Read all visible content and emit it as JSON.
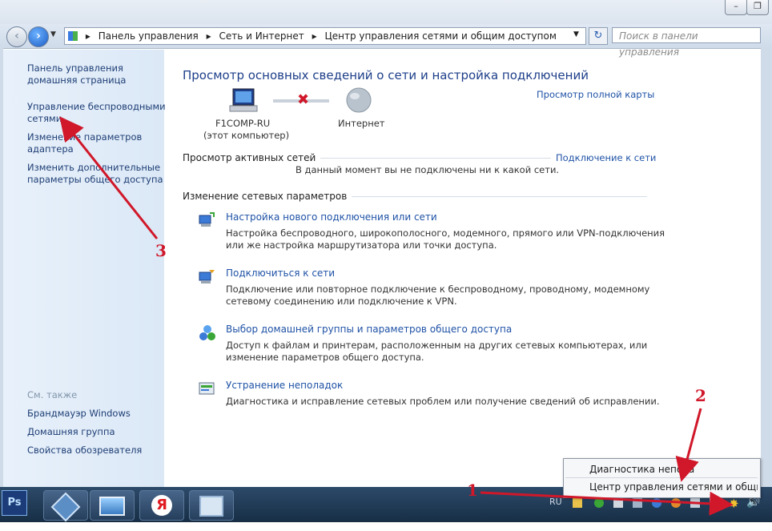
{
  "address": {
    "crumbs": [
      "Панель управления",
      "Сеть и Интернет",
      "Центр управления сетями и общим доступом"
    ],
    "search_placeholder": "Поиск в панели управления"
  },
  "sidebar": {
    "items": [
      {
        "label": "Панель управления\nдомашняя страница"
      },
      {
        "label": "Управление беспроводными\nсетями"
      },
      {
        "label": "Изменение параметров\nадаптера"
      },
      {
        "label": "Изменить дополнительные\nпараметры общего доступа"
      }
    ],
    "see_also": "См. также",
    "see_items": [
      "Брандмауэр Windows",
      "Домашняя группа",
      "Свойства обозревателя"
    ]
  },
  "main": {
    "title": "Просмотр основных сведений о сети и настройка подключений",
    "full_map_link": "Просмотр полной карты",
    "computer_name": "F1COMP-RU",
    "computer_sub": "(этот компьютер)",
    "internet_label": "Интернет",
    "active_networks_label": "Просмотр активных сетей",
    "connect_link": "Подключение к сети",
    "no_connection": "В данный момент вы не подключены ни к какой сети.",
    "change_settings_label": "Изменение сетевых параметров",
    "actions": [
      {
        "title": "Настройка нового подключения или сети",
        "desc": "Настройка беспроводного, широкополосного, модемного, прямого или VPN-подключения\nили же настройка маршрутизатора или точки доступа."
      },
      {
        "title": "Подключиться к сети",
        "desc": "Подключение или повторное подключение к беспроводному, проводному, модемному\nсетевому соединению или подключение к VPN."
      },
      {
        "title": "Выбор домашней группы и параметров общего доступа",
        "desc": "Доступ к файлам и принтерам, расположенным на других сетевых компьютерах, или\nизменение параметров общего доступа."
      },
      {
        "title": "Устранение неполадок",
        "desc": "Диагностика и исправление сетевых проблем или получение сведений об исправлении."
      }
    ]
  },
  "popup": {
    "items": [
      "Диагностика непола",
      "Центр управления сетями и общим до"
    ]
  },
  "taskbar": {
    "ps_label": "Ps",
    "lang": "RU"
  },
  "annotations": {
    "n1": "1",
    "n2": "2",
    "n3": "3"
  },
  "colors": {
    "link": "#1f52a6",
    "arrow": "#d0182a",
    "taskbar": "#1f3956"
  }
}
